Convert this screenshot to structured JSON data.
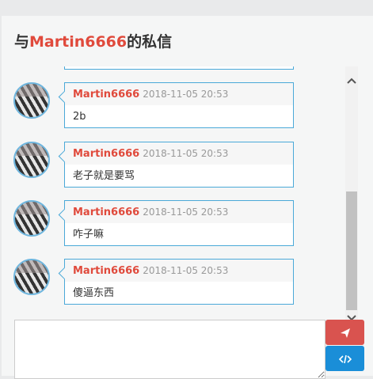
{
  "dialog": {
    "title_prefix": "与",
    "title_user": "Martin6666",
    "title_suffix": "的私信"
  },
  "messages": [
    {
      "author": "Martin6666",
      "time": "2018-11-05 20:53",
      "text": "2b"
    },
    {
      "author": "Martin6666",
      "time": "2018-11-05 20:53",
      "text": "老子就是要骂"
    },
    {
      "author": "Martin6666",
      "time": "2018-11-05 20:53",
      "text": "咋子嘛"
    },
    {
      "author": "Martin6666",
      "time": "2018-11-05 20:53",
      "text": "傻逼东西"
    }
  ],
  "compose": {
    "placeholder": ""
  },
  "icons": {
    "send": "paper-plane-icon",
    "code": "code-icon",
    "up": "chevron-up-icon",
    "down": "chevron-down-icon"
  },
  "colors": {
    "accent": "#e04a3c",
    "bubble_border": "#4aa9d8",
    "send": "#d9534f",
    "code": "#1a8ed8"
  }
}
